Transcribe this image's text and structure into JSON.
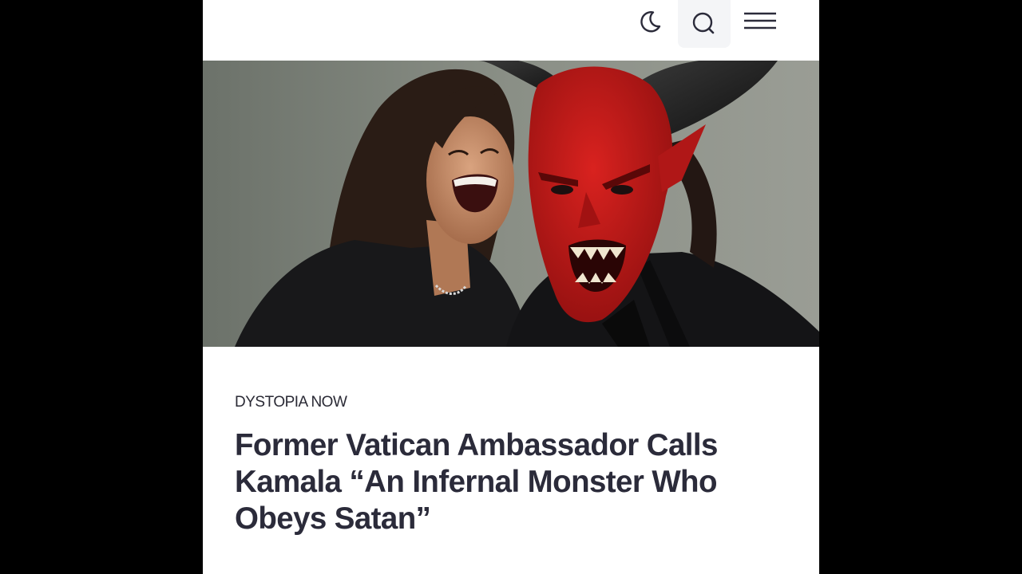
{
  "header": {
    "icons": [
      "moon-icon",
      "search-icon",
      "hamburger-menu-icon"
    ]
  },
  "article": {
    "category": "DYSTOPIA NOW",
    "headline": "Former Vatican Ambassador Calls Kamala “An Infernal Monster Who Obeys Satan”",
    "hero_image": "laughing-woman-and-red-horned-devil-image"
  },
  "colors": {
    "background": "#000000",
    "page": "#ffffff",
    "headline_text": "#2b2b3a",
    "search_button_bg": "#f4f5f7",
    "devil_red": "#c41b1b"
  }
}
